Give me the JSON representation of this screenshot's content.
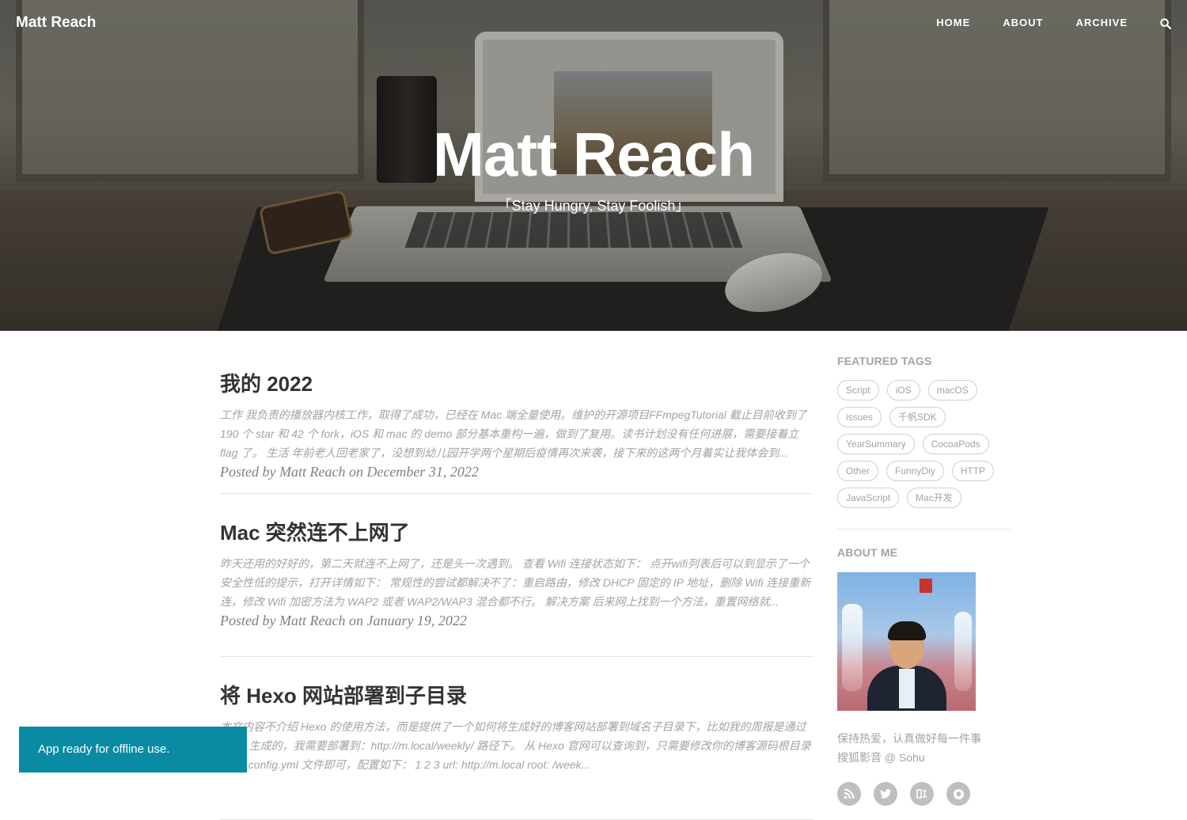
{
  "nav": {
    "brand": "Matt Reach",
    "links": [
      "HOME",
      "ABOUT",
      "ARCHIVE"
    ],
    "search_icon": "search-icon"
  },
  "hero": {
    "title": "Matt Reach",
    "subtitle": "「Stay Hungry, Stay Foolish」"
  },
  "posts": [
    {
      "title": "我的 2022",
      "excerpt": "工作 我负责的播放器内核工作，取得了成功，已经在 Mac 端全量使用。维护的开源项目FFmpegTutorial 截止目前收到了 190 个 star 和 42 个 fork，iOS 和 mac 的 demo 部分基本重构一遍，做到了复用。读书计划没有任何进展，需要接着立 flag 了。 生活 年前老人回老家了，没想到幼儿园开学两个星期后疫情再次来袭，接下来的这两个月着实让我体会到...",
      "meta": "Posted by Matt Reach on December 31, 2022"
    },
    {
      "title": "Mac 突然连不上网了",
      "excerpt": "昨天还用的好好的，第二天就连不上网了，还是头一次遇到。 查看 Wifi 连接状态如下： 点开wifi列表后可以到显示了一个安全性低的提示，打开详情如下： 常规性的尝试都解决不了：重启路由，修改 DHCP 固定的 IP 地址，删除 Wifi 连接重新连，修改 Wifi 加密方法为 WAP2 或者 WAP2/WAP3 混合都不行。 解决方案 后来网上找到一个方法，重置网络就...",
      "meta": "Posted by Matt Reach on January 19, 2022"
    },
    {
      "title": "将 Hexo 网站部署到子目录",
      "excerpt": "本文内容不介绍 Hexo 的使用方法，而是提供了一个如何将生成好的博客网站部署到域名子目录下，比如我的周报是通过 Hexo 生成的，我需要部署到：http://m.local/weekly/ 路径下。 从 Hexo 官网可以查询到，只需要修改你的博客源码根目录下的_config.yml 文件即可，配置如下： 1 2 3 url: http://m.local root: /week...",
      "meta": ""
    }
  ],
  "sidebar": {
    "featured_tags_heading": "FEATURED TAGS",
    "tags": [
      "Script",
      "iOS",
      "macOS",
      "issues",
      "千帆SDK",
      "YearSummary",
      "CocoaPods",
      "Other",
      "FunnyDiy",
      "HTTP",
      "JavaScript",
      "Mac开发"
    ],
    "about_heading": "ABOUT ME",
    "about_line1": "保持热爱，认真做好每一件事",
    "about_line2": "搜狐影音 @ Sohu",
    "social_icons": [
      "rss-icon",
      "twitter-icon",
      "zhihu-icon",
      "github-icon"
    ]
  },
  "toast": {
    "message": "App ready for offline use."
  }
}
